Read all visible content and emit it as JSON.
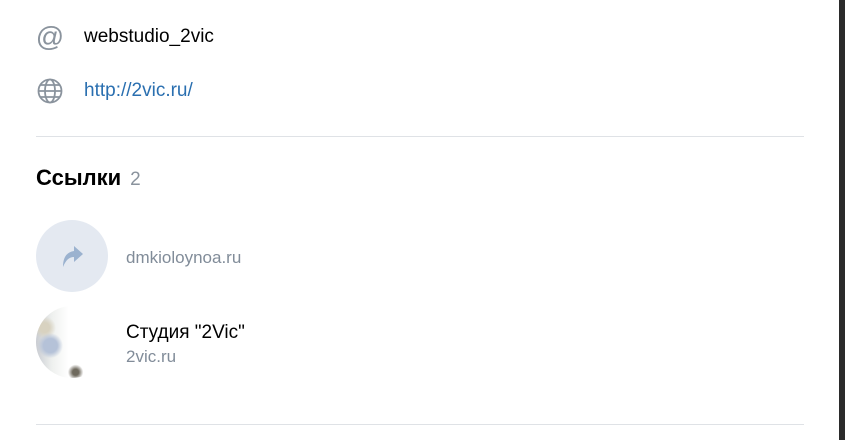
{
  "contacts": {
    "username": "webstudio_2vic",
    "username_icon": "at-icon",
    "website": "http://2vic.ru/",
    "website_icon": "globe-icon"
  },
  "links_section": {
    "title": "Ссылки",
    "count": "2",
    "items": [
      {
        "domain": "dmkioloynoa.ru",
        "icon": "share-arrow-icon"
      },
      {
        "title": "Студия \"2Vic\"",
        "domain": "2vic.ru"
      }
    ]
  },
  "colors": {
    "link": "#2a6fb0",
    "secondary_text": "#818c99",
    "icon_gray": "#8a939d",
    "placeholder_bg": "#e4e9f1",
    "arrow_blue": "#9bb2cf",
    "divider": "#dfe2e6"
  }
}
